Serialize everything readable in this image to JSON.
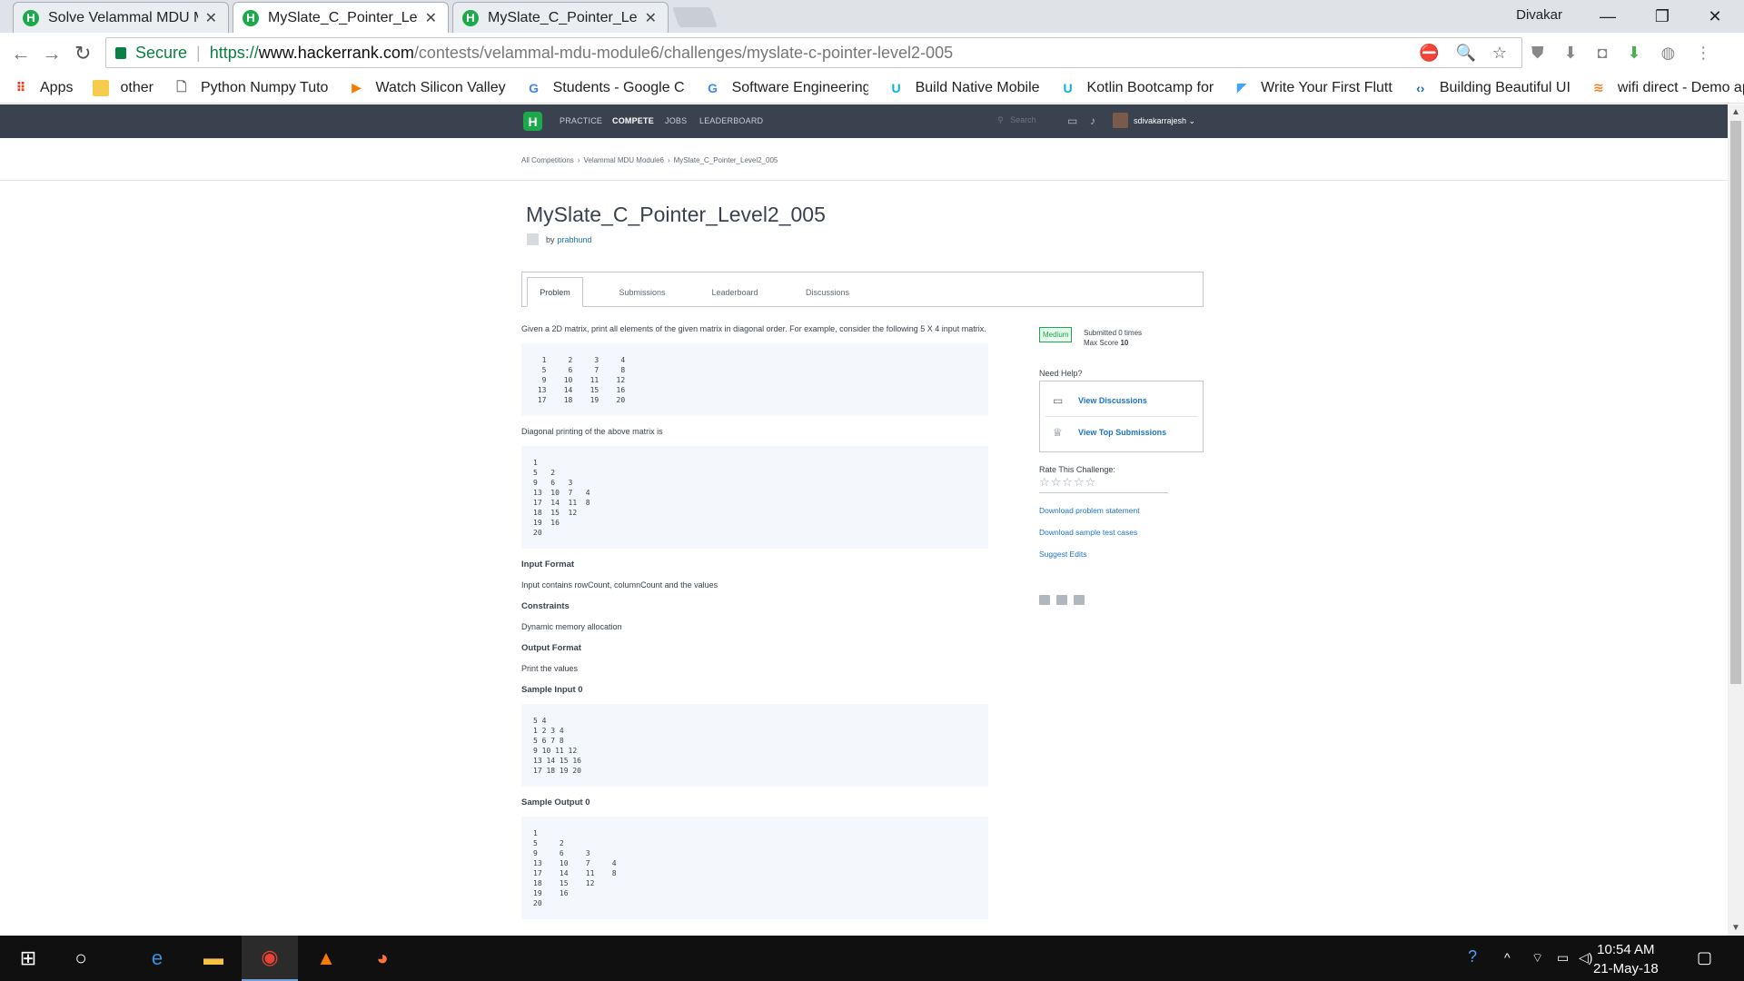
{
  "browser": {
    "tabs": [
      {
        "title": "Solve Velammal MDU Mo",
        "active": false
      },
      {
        "title": "MySlate_C_Pointer_Level2",
        "active": true
      },
      {
        "title": "MySlate_C_Pointer_Level2",
        "active": false
      }
    ],
    "profile_name": "Divakar",
    "secure_label": "Secure",
    "url": {
      "scheme": "https://",
      "host": "www.hackerrank.com",
      "path": "/contests/velammal-mdu-module6/challenges/myslate-c-pointer-level2-005"
    },
    "bookmarks": [
      {
        "label": "Apps",
        "icon": "apps-grid-icon"
      },
      {
        "label": "other",
        "icon": "folder-icon"
      },
      {
        "label": "Python Numpy Tuto",
        "icon": "page-icon"
      },
      {
        "label": "Watch Silicon Valley",
        "icon": "play-icon"
      },
      {
        "label": "Students - Google C",
        "icon": "google-icon"
      },
      {
        "label": "Software Engineering",
        "icon": "google-icon"
      },
      {
        "label": "Build Native Mobile",
        "icon": "udacity-icon"
      },
      {
        "label": "Kotlin Bootcamp for",
        "icon": "udacity-icon"
      },
      {
        "label": "Write Your First Flutt",
        "icon": "flutter-icon"
      },
      {
        "label": "Building Beautiful UI",
        "icon": "code-icon"
      },
      {
        "label": "wifi direct - Demo ap",
        "icon": "stack-icon"
      }
    ]
  },
  "hackerrank": {
    "logo": "H",
    "nav": [
      "PRACTICE",
      "COMPETE",
      "JOBS",
      "LEADERBOARD"
    ],
    "active_nav": "COMPETE",
    "search_placeholder": "Search",
    "username": "sdivakarrajesh",
    "breadcrumbs": [
      "All Competitions",
      "Velammal MDU Module6",
      "MySlate_C_Pointer_Level2_005"
    ],
    "title": "MySlate_C_Pointer_Level2_005",
    "author_prefix": "by",
    "author": "prabhund",
    "problem_tabs": [
      "Problem",
      "Submissions",
      "Leaderboard",
      "Discussions"
    ],
    "active_tab": "Problem",
    "statement": {
      "intro": "Given a 2D matrix, print all elements of the given matrix in diagonal order. For example, consider the following 5 X 4 input matrix.",
      "matrix_code": "  1     2     3     4\n  5     6     7     8\n  9    10    11    12\n 13    14    15    16\n 17    18    19    20",
      "diag_intro": "Diagonal printing of the above matrix is",
      "diag_code": "1\n5   2\n9   6   3\n13  10  7   4\n17  14  11  8\n18  15  12\n19  16\n20",
      "input_format_heading": "Input Format",
      "input_format": "Input contains rowCount, columnCount and the values",
      "constraints_heading": "Constraints",
      "constraints": "Dynamic memory allocation",
      "output_format_heading": "Output Format",
      "output_format": "Print the values",
      "sample_input_heading": "Sample Input 0",
      "sample_input": "5 4\n1 2 3 4\n5 6 7 8\n9 10 11 12\n13 14 15 16\n17 18 19 20",
      "sample_output_heading": "Sample Output 0",
      "sample_output": "1\n5     2\n9     6     3\n13    10    7     4\n17    14    11    8\n18    15    12\n19    16\n20"
    },
    "sidebar": {
      "difficulty": "Medium",
      "submitted": "Submitted 0 times",
      "max_score_label": "Max Score",
      "max_score": "10",
      "need_help": "Need Help?",
      "view_discussions": "View Discussions",
      "view_top_submissions": "View Top Submissions",
      "rate_label": "Rate This Challenge:",
      "stars": "☆☆☆☆☆",
      "download_statement": "Download problem statement",
      "download_tests": "Download sample test cases",
      "suggest_edits": "Suggest Edits"
    }
  },
  "taskbar": {
    "time": "10:54 AM",
    "date": "21-May-18"
  }
}
